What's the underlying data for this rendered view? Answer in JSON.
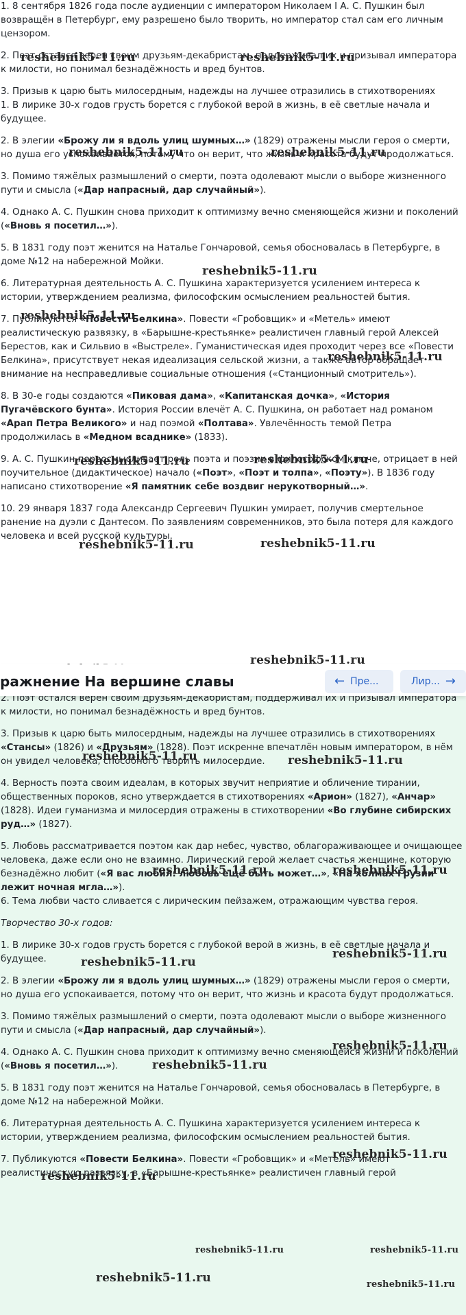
{
  "top": {
    "paragraphs": [
      {
        "k": "t1",
        "html": "1. 8 сентября 1826 года после аудиенции с императором Николаем I А. С. Пушкин был возвращён в Петербург, ему разрешено было творить, но император стал сам его личным цензором."
      },
      {
        "k": "t2",
        "html": "2. Поэт остался верен своим друзьям-декабристам, поддерживал их и призывал императора к милости, но понимал безнадёжность и вред бунтов."
      },
      {
        "k": "t3",
        "tight": true,
        "html": "3. Призыв к царю быть милосердным, надежды на лучшее отразились в стихотворениях"
      },
      {
        "k": "t4",
        "html": "1. В лирике 30-х годов грусть борется с глубокой верой в жизнь, в её светлые начала и будущее."
      },
      {
        "k": "t5",
        "html": "2. В элегии <b>«Брожу ли я вдоль улиц шумных…»</b> (1829) отражены мысли героя о смерти, но душа его успокаивается, потому что он верит, что жизнь и красота будут продолжаться."
      },
      {
        "k": "t6",
        "html": "3. Помимо тяжёлых размышлений о смерти, поэта одолевают мысли о выборе жизненного пути и смысла (<b>«Дар напрасный, дар случайный»</b>)."
      },
      {
        "k": "t7",
        "html": "4. Однако А. С. Пушкин снова приходит к оптимизму вечно сменяющейся жизни и поколений (<b>«Вновь я посетил…»</b>)."
      },
      {
        "k": "t8",
        "html": "5. В 1831 году поэт женится на Наталье Гончаровой, семья обосновалась в Петербурге, в доме №12 на набережной Мойки."
      },
      {
        "k": "t9",
        "html": "6. Литературная деятельность А. С. Пушкина характеризуется усилением интереса к истории, утверждением реализма, философским осмыслением реальностей бытия."
      },
      {
        "k": "t10",
        "html": "7. Публикуются <b>«Повести Белкина»</b>. Повести «Гробовщик» и «Метель» имеют реалистическую развязку, в «Барышне-крестьянке» реалистичен главный герой Алексей Берестов, как и Сильвио в «Выстреле». Гуманистическая идея проходит через все «Повести Белкина», присутствует некая идеализация сельской жизни, а также автор обращает внимание на несправедливые социальные отношения («Станционный смотритель»)."
      },
      {
        "k": "t11",
        "html": "8. В 30-е годы создаются <b>«Пиковая дама»</b>, <b>«Капитанская дочка»</b>, <b>«История Пугачёвского бунта»</b>. История России влечёт А. С. Пушкина, он работает над романом <b>«Арап Петра Великого»</b> и над поэмой <b>«Полтава»</b>. Увлечённость темой Петра продолжилась в <b>«Медном всаднике»</b> (1833)."
      },
      {
        "k": "t12",
        "html": "9. А. С. Пушкин переосмысливает роль поэта и поэзии в философском ключе, отрицает в ней поучительное (дидактическое) начало (<b>«Поэт»</b>, <b>«Поэт и толпа»</b>, <b>«Поэту»</b>). В 1836 году написано стихотворение <b>«Я памятник себе воздвиг нерукотворный…»</b>."
      },
      {
        "k": "t13",
        "html": "10. 29 января 1837 года Александр Сергеевич Пушкин умирает, получив смертельное ранение на дуэли с Дантесом. По заявлениям современников, это была потеря для каждого человека и всей русской культуры."
      }
    ]
  },
  "header": {
    "title": "ражнение На вершине славы",
    "prev_label": "Пре...",
    "next_label": "Лир...",
    "prev_icon": "arrow-left-icon",
    "next_icon": "arrow-right-icon",
    "accent_color": "#2a63c6"
  },
  "bottom": {
    "paragraphs": [
      {
        "k": "b1",
        "html": "2. Поэт остался верен своим друзьям-декабристам, поддерживал их и призывал императора к милости, но понимал безнадёжность и вред бунтов."
      },
      {
        "k": "b2",
        "html": "3. Призыв к царю быть милосердным, надежды на лучшее отразились в стихотворениях <b>«Стансы»</b> (1826) и <b>«Друзьям»</b> (1828). Поэт искренне впечатлён новым императором, в нём он увидел человека, способного творить милосердие."
      },
      {
        "k": "b3",
        "html": "4. Верность поэта своим идеалам, в которых звучит неприятие и обличение тирании, общественных пороков, ясно утверждается в стихотворениях <b>«Арион»</b> (1827), <b>«Анчар»</b> (1828). Идеи гуманизма и милосердия отражены в стихотворении <b>«Во глубине сибирских руд…»</b> (1827)."
      },
      {
        "k": "b4",
        "tight": true,
        "html": "5. Любовь рассматривается поэтом как дар небес, чувство, облагораживающее и очищающее человека, даже если оно не взаимно. Лирический герой желает счастья женщине, которую безнадёжно любит (<b>«Я вас любил: любовь ещё быть может…»</b>, <b>«На холмах Грузии лежит ночная мгла…»</b>)."
      },
      {
        "k": "b5",
        "html": "6. Тема любви часто сливается с лирическим пейзажем, отражающим чувства героя."
      },
      {
        "k": "b6",
        "html": "<span class=\"em\">Творчество 30-х годов:</span>"
      },
      {
        "k": "b7",
        "html": "1. В лирике 30-х годов грусть борется с глубокой верой в жизнь, в её светлые начала и будущее."
      },
      {
        "k": "b8",
        "html": "2. В элегии <b>«Брожу ли я вдоль улиц шумных…»</b> (1829) отражены мысли героя о смерти, но душа его успокаивается, потому что он верит, что жизнь и красота будут продолжаться."
      },
      {
        "k": "b9",
        "html": "3. Помимо тяжёлых размышлений о смерти, поэта одолевают мысли о выборе жизненного пути и смысла (<b>«Дар напрасный, дар случайный»</b>)."
      },
      {
        "k": "b10",
        "html": "4. Однако А. С. Пушкин снова приходит к оптимизму вечно сменяющейся жизни и поколений (<b>«Вновь я посетил…»</b>)."
      },
      {
        "k": "b11",
        "html": "5. В 1831 году поэт женится на Наталье Гончаровой, семья обосновалась в Петербурге, в доме №12 на набережной Мойки."
      },
      {
        "k": "b12",
        "html": "6. Литературная деятельность А. С. Пушкина характеризуется усилением интереса к истории, утверждением реализма, философским осмыслением реальностей бытия."
      },
      {
        "k": "b13",
        "html": "7. Публикуются <b>«Повести Белкина»</b>. Повести «Гробовщик» и «Метель» имеют реалистическую развязку, в «Барышне-крестьянке» реалистичен главный герой"
      }
    ]
  },
  "watermark": {
    "text": "reshebnik5-11.ru"
  }
}
